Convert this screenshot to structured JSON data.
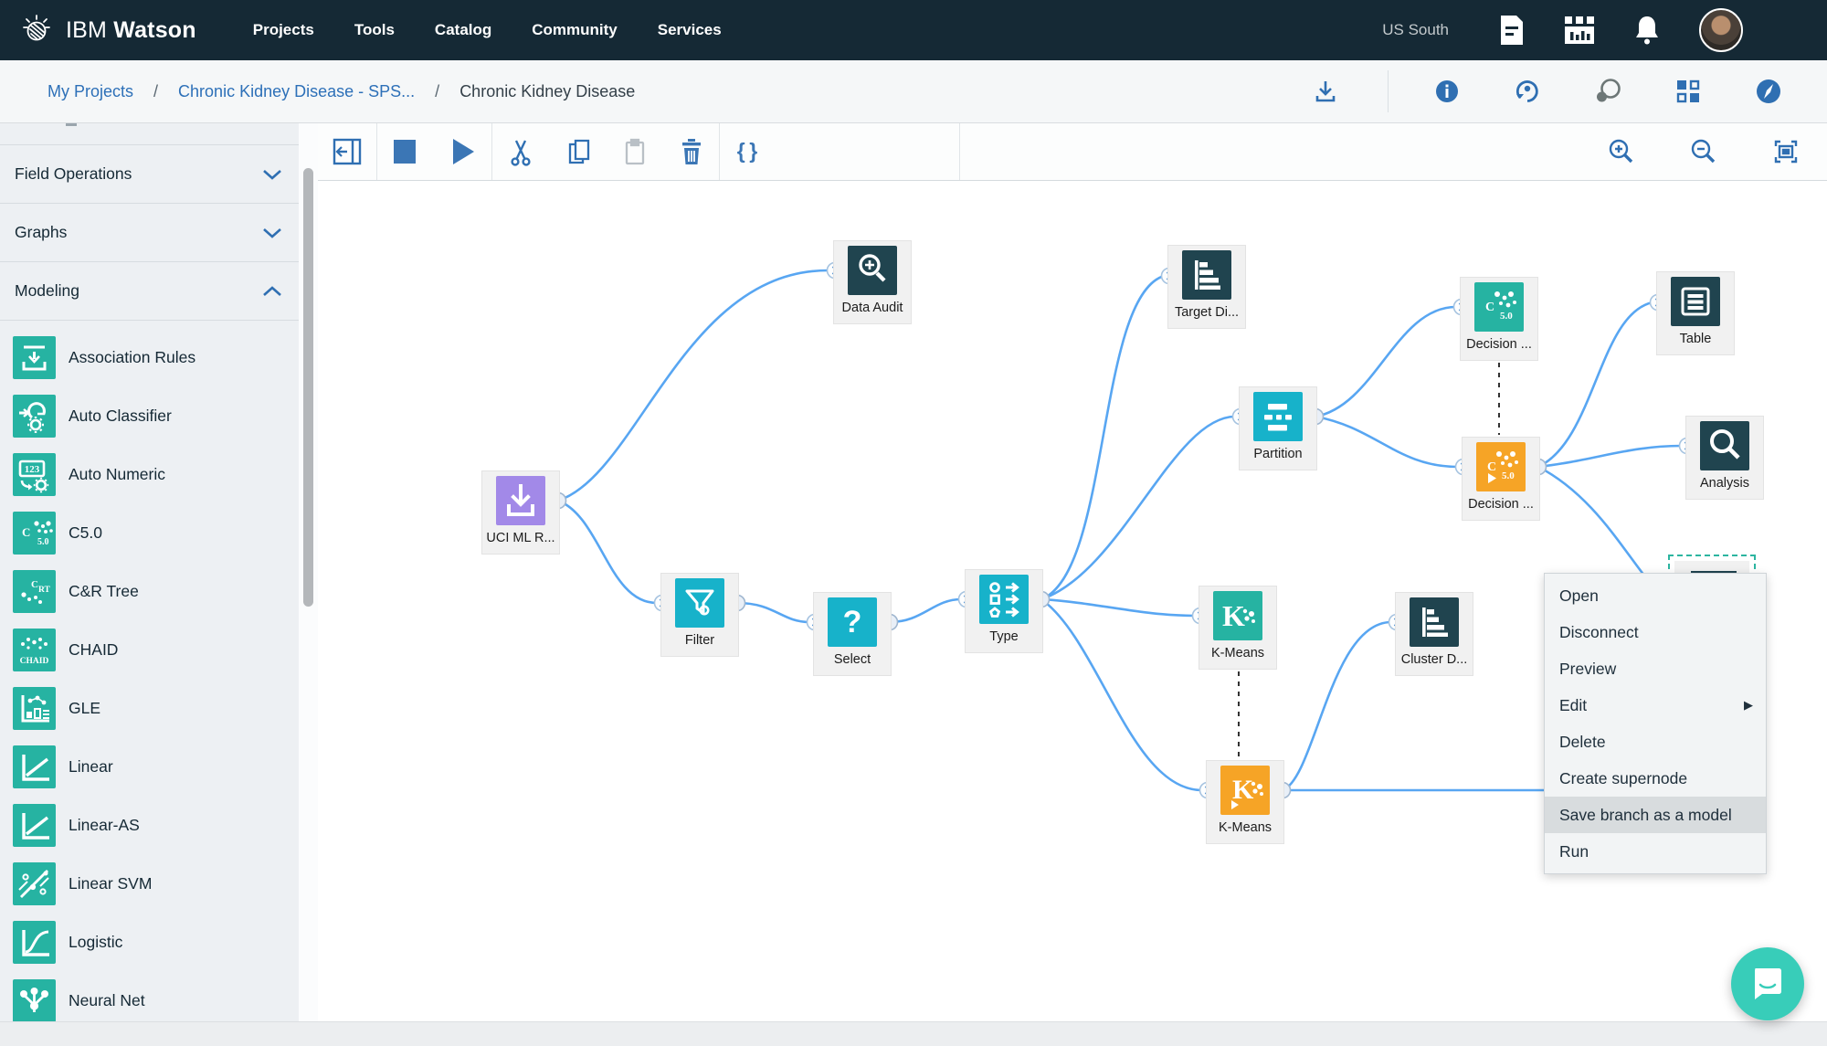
{
  "nav": {
    "brand_prefix": "IBM ",
    "brand_bold": "Watson",
    "items": [
      {
        "label": "Projects"
      },
      {
        "label": "Tools"
      },
      {
        "label": "Catalog"
      },
      {
        "label": "Community"
      },
      {
        "label": "Services"
      }
    ],
    "region": "US South",
    "icons": [
      "document-icon",
      "apps-icon",
      "notifications-bell-icon",
      "avatar"
    ]
  },
  "breadcrumb": {
    "separator": "/",
    "items": [
      {
        "label": "My Projects",
        "link": true
      },
      {
        "label": "Chronic Kidney Disease - SPS...",
        "link": true
      },
      {
        "label": "Chronic Kidney Disease",
        "link": false
      }
    ],
    "actions": [
      "download-icon",
      "info-icon",
      "history-icon",
      "comments-icon",
      "blocks-icon",
      "compass-icon"
    ]
  },
  "sidebar": {
    "sections": [
      {
        "label": "Field Operations",
        "state": "collapsed"
      },
      {
        "label": "Graphs",
        "state": "collapsed"
      },
      {
        "label": "Modeling",
        "state": "expanded"
      }
    ],
    "model_items": [
      {
        "label": "Association Rules"
      },
      {
        "label": "Auto Classifier"
      },
      {
        "label": "Auto Numeric"
      },
      {
        "label": "C5.0"
      },
      {
        "label": "C&R Tree"
      },
      {
        "label": "CHAID"
      },
      {
        "label": "GLE"
      },
      {
        "label": "Linear"
      },
      {
        "label": "Linear-AS"
      },
      {
        "label": "Linear SVM"
      },
      {
        "label": "Logistic"
      },
      {
        "label": "Neural Net"
      }
    ]
  },
  "toolbar": {
    "icons": [
      "hide-palette",
      "stop",
      "run",
      "cut",
      "copy",
      "paste",
      "delete",
      "code-braces",
      "zoom-in",
      "zoom-out",
      "fit-to-view"
    ]
  },
  "canvas": {
    "nodes": [
      {
        "label": "UCI ML R...",
        "type": "source-import"
      },
      {
        "label": "Data Audit",
        "type": "output-data-audit"
      },
      {
        "label": "Filter",
        "type": "filter"
      },
      {
        "label": "Select",
        "type": "select"
      },
      {
        "label": "Type",
        "type": "type"
      },
      {
        "label": "Target Di...",
        "type": "graph-distribution"
      },
      {
        "label": "Partition",
        "type": "partition"
      },
      {
        "label": "Decision ...",
        "type": "c50-model"
      },
      {
        "label": "Decision ...",
        "type": "c50-model-nugget"
      },
      {
        "label": "Table",
        "type": "output-table"
      },
      {
        "label": "Analysis",
        "type": "output-analysis"
      },
      {
        "label": "K-Means",
        "type": "kmeans-model"
      },
      {
        "label": "K-Means",
        "type": "kmeans-model-nugget"
      },
      {
        "label": "Cluster D...",
        "type": "graph-distribution"
      }
    ],
    "context_menu": {
      "items": [
        {
          "label": "Open"
        },
        {
          "label": "Disconnect"
        },
        {
          "label": "Preview"
        },
        {
          "label": "Edit",
          "submenu": "▶"
        },
        {
          "label": "Delete"
        },
        {
          "label": "Create supernode"
        },
        {
          "label": "Save branch as a model",
          "highlighted": true
        },
        {
          "label": "Run"
        }
      ]
    }
  },
  "colors": {
    "nav_bg": "#152935",
    "link_blue": "#2d70b8",
    "icon_blue": "#2f6fb2",
    "wire_blue": "#58a6f2",
    "node_cyan": "#17b2ca",
    "node_dark_teal": "#20444f",
    "node_purple": "#a289e8",
    "node_green_teal": "#26b3a2",
    "node_orange": "#f6a426",
    "chat_teal": "#38cdb9"
  }
}
